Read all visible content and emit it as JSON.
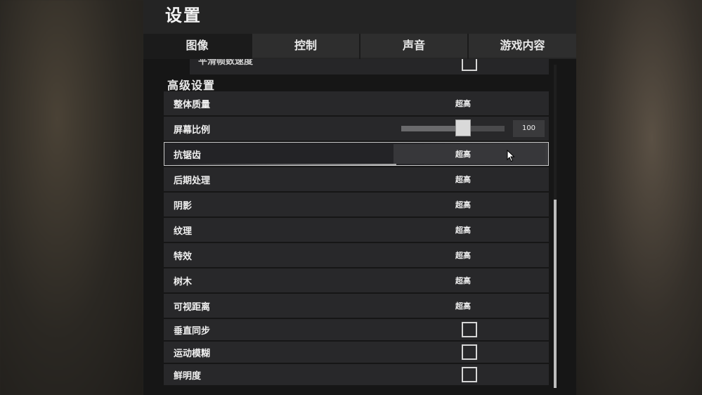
{
  "window": {
    "title": "设置"
  },
  "tabs": [
    {
      "label": "图像",
      "active": true
    },
    {
      "label": "控制",
      "active": false
    },
    {
      "label": "声音",
      "active": false
    },
    {
      "label": "游戏内容",
      "active": false
    }
  ],
  "partial_row": {
    "label": "平滑帧数速度",
    "checked": false
  },
  "section": {
    "title": "高级设置"
  },
  "settings": [
    {
      "label": "整体质量",
      "type": "select",
      "value": "超高"
    },
    {
      "label": "屏幕比例",
      "type": "slider",
      "value": "100",
      "fraction": 0.6
    },
    {
      "label": "抗锯齿",
      "type": "select",
      "value": "超高",
      "selected": true
    },
    {
      "label": "后期处理",
      "type": "select",
      "value": "超高"
    },
    {
      "label": "阴影",
      "type": "select",
      "value": "超高"
    },
    {
      "label": "纹理",
      "type": "select",
      "value": "超高"
    },
    {
      "label": "特效",
      "type": "select",
      "value": "超高"
    },
    {
      "label": "树木",
      "type": "select",
      "value": "超高"
    },
    {
      "label": "可视距离",
      "type": "select",
      "value": "超高"
    },
    {
      "label": "垂直同步",
      "type": "checkbox",
      "checked": false
    },
    {
      "label": "运动模糊",
      "type": "checkbox",
      "checked": false
    },
    {
      "label": "鲜明度",
      "type": "checkbox",
      "checked": false
    }
  ],
  "colors": {
    "panel": "#1b1b1b",
    "row": "#28282a",
    "accent": "#d9d9d9"
  }
}
